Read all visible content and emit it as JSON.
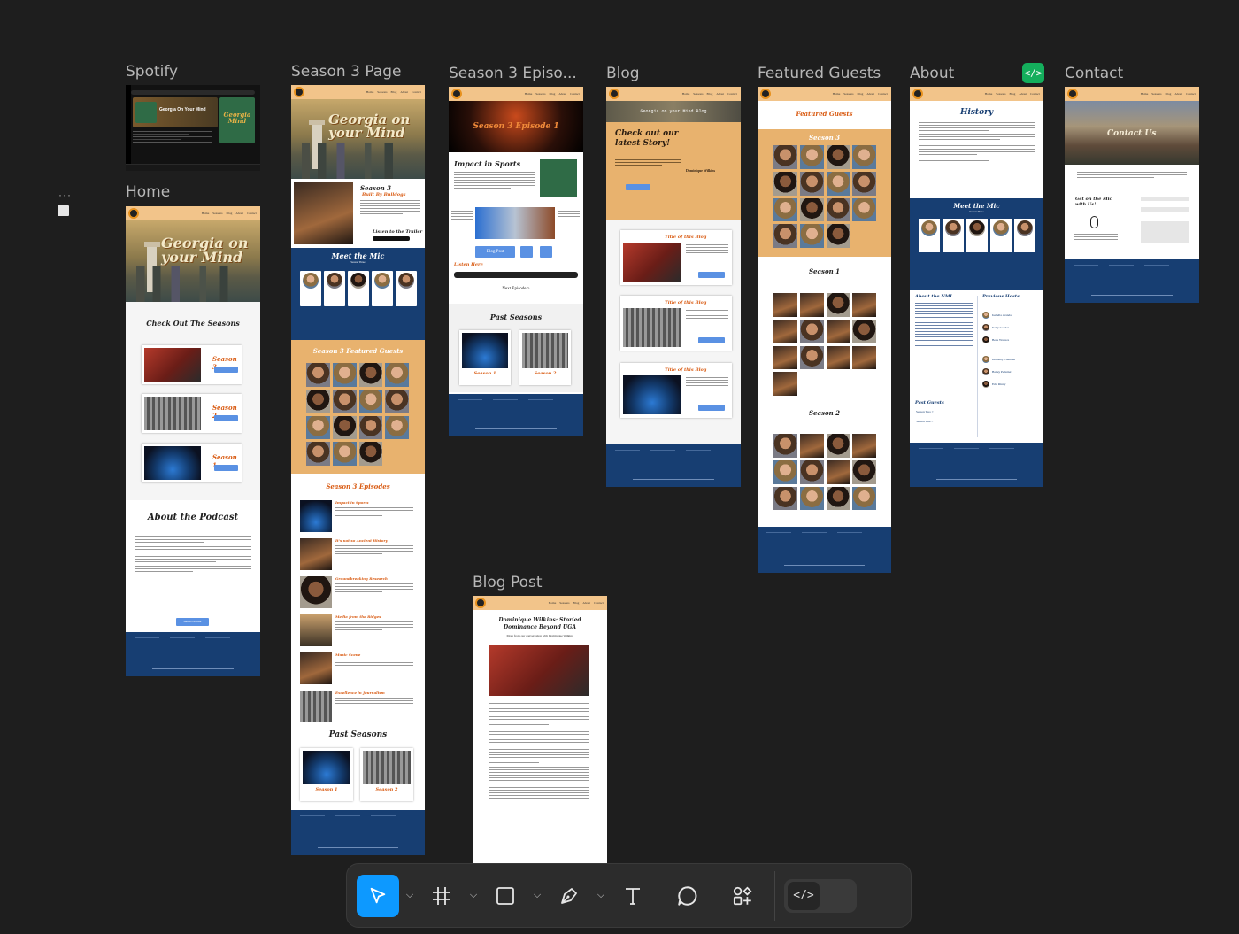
{
  "frames": {
    "spotify": "Spotify",
    "season3_page": "Season 3 Page",
    "season3_episode": "Season 3 Episo...",
    "blog": "Blog",
    "featured_guests": "Featured Guests",
    "about": "About",
    "contact": "Contact",
    "home": "Home",
    "blog_post": "Blog Post"
  },
  "site": {
    "nav": [
      "Home",
      "Seasons",
      "Blog",
      "About",
      "Contact"
    ],
    "hero_title": "Georgia on your Mind",
    "spotify_title": "Georgia On Your Mind",
    "spotify_art": "Georgia Mind",
    "home_seasons_heading": "Check Out The Seasons",
    "season_labels": [
      "Season 3",
      "Season 2",
      "Season 1"
    ],
    "about_heading": "About the Podcast",
    "learn_more": "LEARN MORE",
    "learn_more_btn": "Learn More",
    "s3_title": "Season 3",
    "s3_subtitle": "Built By Bulldogs",
    "listen_trailer": "Listen to the Trailer",
    "meet_mic": "Meet the Mic",
    "season_three": "Season Three",
    "s3_featured": "Season 3 Featured Guests",
    "s3_episodes": "Season 3 Episodes",
    "episodes": [
      "Impact in Sports",
      "It's not so Ancient History",
      "Groundbreaking Research",
      "Media from the Ridges",
      "Music Scene",
      "Excellence in Journalism"
    ],
    "past_seasons": "Past Seasons",
    "past_labels": [
      "Season 1",
      "Season 2"
    ],
    "episode_banner": "Season 3 Episode 1",
    "episode_title": "Impact in Sports",
    "blog_post_btn": "Blog Post",
    "listen_here": "Listen Here",
    "next_episode": "Next Episode >",
    "blog_banner": "Georgia on your Mind Blog",
    "blog_cta": "Check out our latest Story!",
    "blog_feature_name": "Dominique Wilkins",
    "blog_item_title": "Title of this Blog",
    "read_more": "Read More",
    "fg_heading": "Featured Guests",
    "fg_seasons": [
      "Season 3",
      "Season 1",
      "Season 2"
    ],
    "about_history": "History",
    "about_nm": "About the NMI",
    "previous_hosts": "Previous Hosts",
    "past_guests": "Past Guests",
    "season_two_link": "Season Two >",
    "season_one_link": "Season One >",
    "hosts": [
      "Isabella Aranda",
      "Kelly Conder",
      "Beau Wallace",
      "Berkeley Chandler",
      "Bailey Pelletier",
      "Erin Rinny"
    ],
    "contact_heading": "Contact Us",
    "contact_mic": "Get on the Mic with Us!",
    "post_title": "Dominique Wilkins: Storied Dominance Beyond UGA",
    "post_subtitle": "More from our conversation with Dominique Wilkins"
  },
  "toolbar": {
    "tools": [
      "move-tool",
      "frame-tool",
      "shape-tool",
      "pen-tool",
      "text-tool",
      "comment-tool",
      "actions-tool"
    ],
    "dev_mode": "</>"
  }
}
